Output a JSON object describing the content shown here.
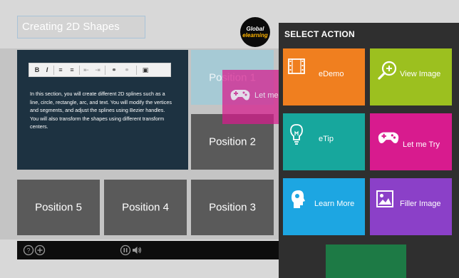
{
  "header": {
    "title": "Creating 2D Shapes",
    "logo_line1": "Global",
    "logo_line2": "elearning"
  },
  "editor": {
    "toolbar": {
      "bold": "B",
      "italic": "I",
      "ordered_list": "≡",
      "unordered_list": "≡",
      "outdent": "⇤",
      "indent": "⇥",
      "link": "⚭",
      "unlink": "⚭",
      "image": "▣"
    },
    "body": "In this section, you will create different 2D splines such as a line, circle, rectangle, arc, and text. You will modify the vertices and segments, and adjust the splines using Bezier handles. You will also transform the shapes using different transform centers."
  },
  "positions": [
    {
      "label": "Position 1"
    },
    {
      "label": "Position 2"
    },
    {
      "label": "Position 3"
    },
    {
      "label": "Position 4"
    },
    {
      "label": "Position 5"
    }
  ],
  "dragging_tile": {
    "label": "Let me Try",
    "icon": "gamepad-icon"
  },
  "action_panel": {
    "title": "SELECT ACTION",
    "tiles": [
      {
        "label": "eDemo",
        "icon": "film-icon",
        "color": "#f07f1f"
      },
      {
        "label": "View Image",
        "icon": "magnify-plus-icon",
        "color": "#9cc01f"
      },
      {
        "label": "eTip",
        "icon": "lightbulb-icon",
        "color": "#17a79d"
      },
      {
        "label": "Let me Try",
        "icon": "gamepad-icon",
        "color": "#d81b8e"
      },
      {
        "label": "Learn More",
        "icon": "head-idea-icon",
        "color": "#1da6e2"
      },
      {
        "label": "Filler Image",
        "icon": "picture-icon",
        "color": "#8b40c8"
      }
    ]
  },
  "bottom_bar": {
    "icons": [
      "help-icon",
      "add-icon",
      "pause-icon",
      "volume-icon"
    ]
  }
}
